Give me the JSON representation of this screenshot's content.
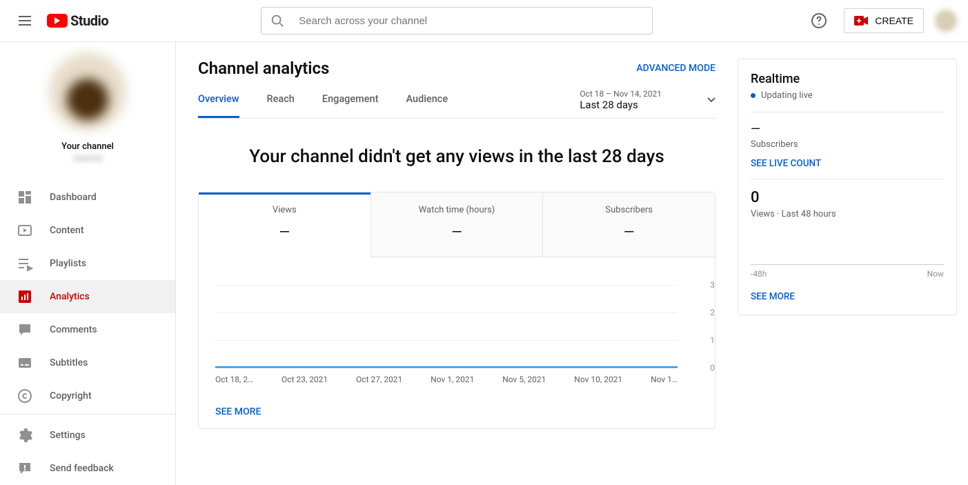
{
  "header": {
    "logo_text": "Studio",
    "search_placeholder": "Search across your channel",
    "create_label": "CREATE"
  },
  "sidebar": {
    "your_channel_label": "Your channel",
    "channel_name": "channel",
    "items": [
      {
        "label": "Dashboard"
      },
      {
        "label": "Content"
      },
      {
        "label": "Playlists"
      },
      {
        "label": "Analytics"
      },
      {
        "label": "Comments"
      },
      {
        "label": "Subtitles"
      },
      {
        "label": "Copyright"
      }
    ],
    "bottom": [
      {
        "label": "Settings"
      },
      {
        "label": "Send feedback"
      }
    ]
  },
  "page": {
    "title": "Channel analytics",
    "advanced_mode": "ADVANCED MODE",
    "tabs": [
      {
        "label": "Overview",
        "active": true
      },
      {
        "label": "Reach"
      },
      {
        "label": "Engagement"
      },
      {
        "label": "Audience"
      }
    ],
    "date_range": {
      "range": "Oct 18 – Nov 14, 2021",
      "label": "Last 28 days"
    },
    "overview_headline": "Your channel didn't get any views in the last 28 days",
    "metric_tabs": [
      {
        "title": "Views",
        "value": "—",
        "active": true
      },
      {
        "title": "Watch time (hours)",
        "value": "—"
      },
      {
        "title": "Subscribers",
        "value": "—"
      }
    ],
    "see_more": "SEE MORE"
  },
  "chart_data": {
    "type": "line",
    "title": "Views",
    "categories": [
      "Oct 18, 2…",
      "Oct 23, 2021",
      "Oct 27, 2021",
      "Nov 1, 2021",
      "Nov 5, 2021",
      "Nov 10, 2021",
      "Nov 1…"
    ],
    "values": [
      0,
      0,
      0,
      0,
      0,
      0,
      0
    ],
    "ylabel": "",
    "ylim": [
      0,
      3
    ],
    "yticks": [
      0,
      1,
      2,
      3
    ]
  },
  "realtime": {
    "title": "Realtime",
    "updating": "Updating live",
    "subscribers_value": "—",
    "subscribers_label": "Subscribers",
    "see_live_count": "SEE LIVE COUNT",
    "views_48h_value": "0",
    "views_48h_label": "Views · Last 48 hours",
    "time_left": "-48h",
    "time_right": "Now",
    "see_more": "SEE MORE"
  }
}
